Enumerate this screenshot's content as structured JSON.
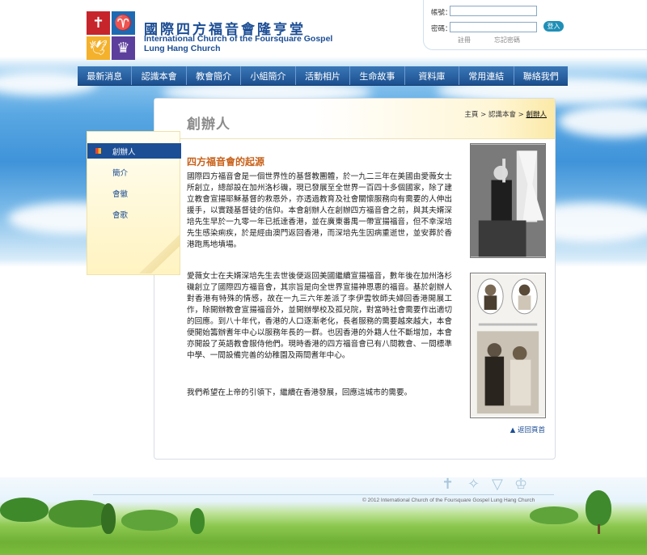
{
  "header": {
    "org_name_zh": "國際四方福音會隆亨堂",
    "org_name_en_line1": "International Church of the Foursquare Gospel",
    "org_name_en_line2": "Lung Hang Church"
  },
  "login": {
    "account_label": "帳號：",
    "password_label": "密碼：",
    "login_button": "登入",
    "register_link": "註冊",
    "forgot_link": "忘記密碼"
  },
  "nav": {
    "items": [
      "最新消息",
      "認識本會",
      "教會簡介",
      "小組簡介",
      "活動相片",
      "生命故事",
      "資料庫",
      "常用連結",
      "聯絡我們"
    ]
  },
  "sidebar": {
    "items": [
      {
        "label": "創辦人",
        "active": true
      },
      {
        "label": "簡介",
        "active": false
      },
      {
        "label": "會徽",
        "active": false
      },
      {
        "label": "會歌",
        "active": false
      }
    ]
  },
  "main": {
    "page_title": "創辦人",
    "breadcrumb": {
      "home": "主頁",
      "sep1": " > ",
      "parent": "認識本會",
      "sep2": " > ",
      "current": "創辦人"
    },
    "section_title": "四方福音會的起源",
    "paragraphs": [
      "國際四方福音會是一個世界性的基督教團體，於一九二三年在美國由愛薇女士所創立，總部設在加州洛杉磯，現已發展至全世界一百四十多個國家，除了建立教會宣揚耶穌基督的救恩外，亦透過教育及社會關懷服務向有需要的人伸出援手，以實踐基督徒的信仰。本會創辦人在創辦四方福音會之前，與其夫婿深培先生早於一九零一年已抵達香港，並在廣東番禺一帶宣揚福音，但不幸深培先生感染痢疾，於是經由澳門返回香港，而深培先生因病重逝世，並安葬於香港跑馬地墳場。",
      "愛薇女士在夫婿深培先生去世後便返回美國繼續宣揚福音，數年後在加州洛杉磯創立了國際四方福音會，其宗旨是向全世界宣揚神恩惠的福音。基於創辦人對香港有特殊的情感，故在一九三六年差派了李伊雲牧師夫婦回香港開展工作，除開辦教會宣揚福音外，並開辦學校及孤兒院，對當時社會需要作出適切的回應。到八十年代，香港的人口逐漸老化，長者服務的需要越來越大，本會便開始籌辦耆年中心以服務年長的一群。也因香港的外籍人仕不斷增加，本會亦開設了英語教會服侍他們。現時香港的四方福音會已有八間教會、一間標準中學、一間設備完善的幼稚園及兩間耆年中心。",
      "我們希望在上帝的引領下，繼續在香港發展，回應這城市的需要。"
    ],
    "back_to_top": "▲ 返回頁首"
  },
  "footer": {
    "copyright": "© 2012 International Church of the Foursquare Gospel Lung Hang Church"
  }
}
